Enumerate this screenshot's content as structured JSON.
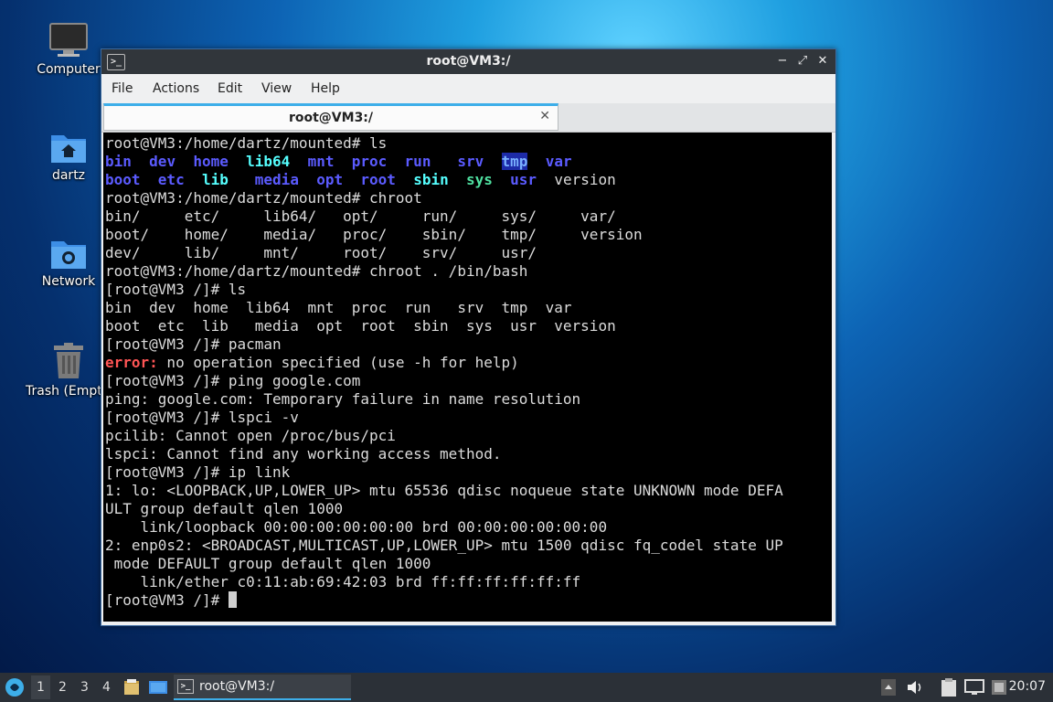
{
  "desktop": {
    "icons": [
      {
        "label": "Computer",
        "icon": "monitor-icon"
      },
      {
        "label": "dartz",
        "icon": "home-folder-icon"
      },
      {
        "label": "Network",
        "icon": "network-folder-icon"
      },
      {
        "label": "Trash (Empty)",
        "icon": "trash-icon"
      }
    ]
  },
  "window": {
    "title": "root@VM3:/",
    "controls": {
      "minimize": "−",
      "maximize": "⤢",
      "close": "✕"
    },
    "menu": [
      "File",
      "Actions",
      "Edit",
      "View",
      "Help"
    ],
    "tab": {
      "label": "root@VM3:/",
      "close": "✕"
    }
  },
  "terminal": {
    "prompt_mounted": "root@VM3:/home/dartz/mounted# ",
    "prompt_root": "[root@VM3 /]# ",
    "lines": {
      "l1": "ls",
      "l2": [
        "bin",
        "dev",
        "home",
        "lib64",
        "mnt",
        "proc",
        "run",
        "srv",
        "tmp",
        "var"
      ],
      "l3": [
        "boot",
        "etc",
        "lib",
        "media",
        "opt",
        "root",
        "sbin",
        "sys",
        "usr",
        "version"
      ],
      "l4": "chroot",
      "l5": "bin/     etc/     lib64/   opt/     run/     sys/     var/",
      "l6": "boot/    home/    media/   proc/    sbin/    tmp/     version",
      "l7": "dev/     lib/     mnt/     root/    srv/     usr/",
      "l8": "chroot . /bin/bash",
      "l9": "ls",
      "l10": "bin  dev  home  lib64  mnt  proc  run   srv  tmp  var",
      "l11": "boot  etc  lib   media  opt  root  sbin  sys  usr  version",
      "l12": "pacman",
      "l13_err": "error:",
      "l13_msg": " no operation specified (use -h for help)",
      "l14": "ping google.com",
      "l15": "ping: google.com: Temporary failure in name resolution",
      "l16": "lspci -v",
      "l17": "pcilib: Cannot open /proc/bus/pci",
      "l18": "lspci: Cannot find any working access method.",
      "l19": "ip link",
      "l20": "1: lo: <LOOPBACK,UP,LOWER_UP> mtu 65536 qdisc noqueue state UNKNOWN mode DEFA",
      "l21": "ULT group default qlen 1000",
      "l22": "    link/loopback 00:00:00:00:00:00 brd 00:00:00:00:00:00",
      "l23": "2: enp0s2: <BROADCAST,MULTICAST,UP,LOWER_UP> mtu 1500 qdisc fq_codel state UP",
      "l24": " mode DEFAULT group default qlen 1000",
      "l25": "    link/ether c0:11:ab:69:42:03 brd ff:ff:ff:ff:ff:ff"
    }
  },
  "taskbar": {
    "start_icon": "start-menu-icon",
    "workspaces": [
      "1",
      "2",
      "3",
      "4"
    ],
    "task_label": "root@VM3:/",
    "clock": "20:07",
    "colors": {
      "accent": "#3daee9"
    }
  }
}
